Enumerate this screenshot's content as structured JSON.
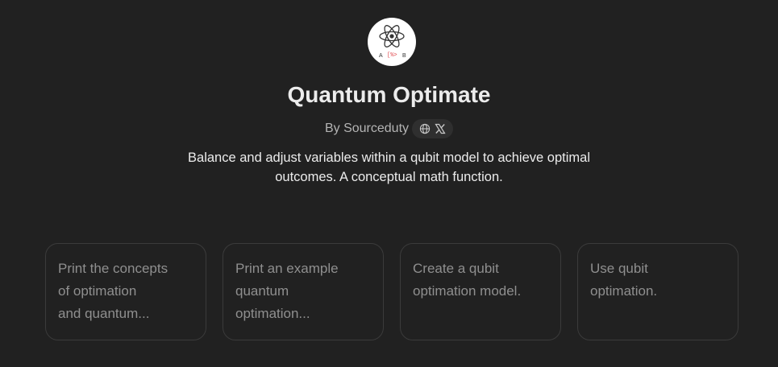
{
  "gpt": {
    "name": "Quantum Optimate",
    "byline": "By Sourceduty",
    "description": "Balance and adjust variables within a qubit model to achieve optimal outcomes. A conceptual math function."
  },
  "avatar": {
    "left_label": "A",
    "middle_label": "[%>",
    "right_label": "B"
  },
  "social_icons": [
    "globe-icon",
    "x-icon"
  ],
  "conversation_starters": [
    {
      "line1": "Print the concepts",
      "line2": "of optimation",
      "line3": "and quantum..."
    },
    {
      "line1": "Print an example",
      "line2": "quantum",
      "line3": "optimation..."
    },
    {
      "line1": "Create a qubit",
      "line2": "optimation model.",
      "line3": ""
    },
    {
      "line1": "Use qubit",
      "line2": "optimation.",
      "line3": ""
    }
  ],
  "colors": {
    "background": "#212121",
    "text": "#ececec",
    "muted_text": "#b4b4b4",
    "starter_text": "#8f8f8f",
    "starter_border": "#3b3b3b",
    "avatar_accent": "#e0474c"
  }
}
